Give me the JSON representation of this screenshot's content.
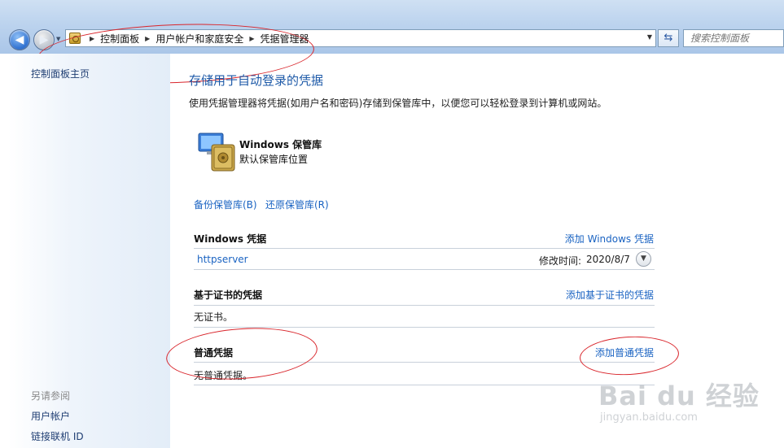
{
  "address_bar": {
    "breadcrumbs": [
      "控制面板",
      "用户帐户和家庭安全",
      "凭据管理器"
    ],
    "search_placeholder": "搜索控制面板"
  },
  "sidebar": {
    "home_link": "控制面板主页",
    "see_also_heading": "另请参阅",
    "see_also_links": [
      "用户帐户",
      "链接联机 ID"
    ]
  },
  "main": {
    "title": "存储用于自动登录的凭据",
    "description": "使用凭据管理器将凭据(如用户名和密码)存储到保管库中，以便您可以轻松登录到计算机或网站。",
    "vault": {
      "name": "Windows 保管库",
      "subtitle": "默认保管库位置"
    },
    "backup_link": "备份保管库(B)",
    "restore_link": "还原保管库(R)",
    "sections": {
      "windows": {
        "title": "Windows 凭据",
        "add_link": "添加 Windows 凭据",
        "items": [
          {
            "name": "httpserver",
            "modified_label": "修改时间:",
            "modified_date": "2020/8/7"
          }
        ]
      },
      "certificate": {
        "title": "基于证书的凭据",
        "add_link": "添加基于证书的凭据",
        "empty_text": "无证书。"
      },
      "generic": {
        "title": "普通凭据",
        "add_link": "添加普通凭据",
        "empty_text": "无普通凭据。"
      }
    }
  },
  "watermark": {
    "main": "Bai du 经验",
    "sub": "jingyan.baidu.com"
  },
  "colors": {
    "link": "#1a63c2",
    "title": "#1e5aa8",
    "annotation": "#d9262c"
  },
  "icons": [
    "back-arrow-icon",
    "forward-arrow-icon",
    "control-panel-icon",
    "refresh-icon",
    "vault-icon",
    "chevron-down-icon"
  ]
}
